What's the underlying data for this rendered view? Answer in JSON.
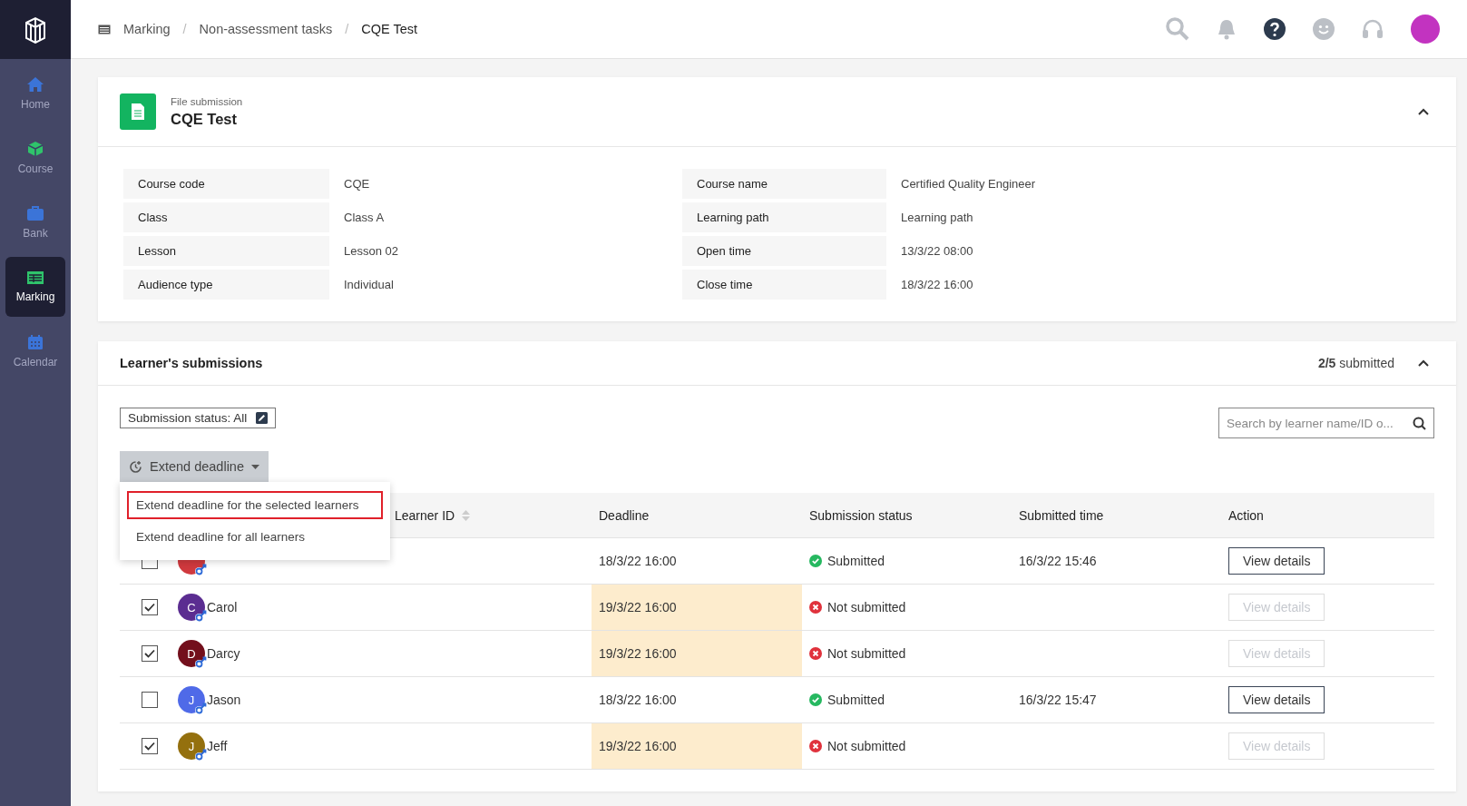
{
  "sidebar": {
    "items": [
      {
        "label": "Home",
        "kind": "home",
        "selected": false
      },
      {
        "label": "Course",
        "kind": "course",
        "selected": false
      },
      {
        "label": "Bank",
        "kind": "bank",
        "selected": false
      },
      {
        "label": "Marking",
        "kind": "marking",
        "selected": true
      },
      {
        "label": "Calendar",
        "kind": "calendar",
        "selected": false
      }
    ]
  },
  "breadcrumb": [
    {
      "kind": "link",
      "label": "Marking"
    },
    {
      "kind": "separator",
      "label": "/"
    },
    {
      "kind": "link",
      "label": "Non-assessment tasks"
    },
    {
      "kind": "separator",
      "label": "/"
    },
    {
      "kind": "current",
      "label": "CQE Test"
    }
  ],
  "task": {
    "type": "File submission",
    "title": "CQE Test",
    "expanded": true,
    "details": [
      {
        "label": "Course code",
        "value": "CQE"
      },
      {
        "label": "Course name",
        "value": "Certified Quality Engineer"
      },
      {
        "label": "Class",
        "value": "Class A"
      },
      {
        "label": "Learning path",
        "value": "Learning path"
      },
      {
        "label": "Lesson",
        "value": "Lesson 02"
      },
      {
        "label": "Open time",
        "value": "13/3/22 08:00"
      },
      {
        "label": "Audience type",
        "value": "Individual"
      },
      {
        "label": "Close time",
        "value": "18/3/22 16:00"
      }
    ]
  },
  "submissions": {
    "title": "Learner's submissions",
    "count": "2/5",
    "count_suffix": "submitted",
    "expanded": true,
    "filter": "Submission status: All",
    "search": {
      "placeholder": "Search by learner name/ID o..."
    },
    "extend_button": "Extend deadline",
    "menu": [
      {
        "label": "Extend deadline for the selected learners",
        "selected": true
      },
      {
        "label": "Extend deadline for all learners",
        "selected": false
      }
    ],
    "columns": [
      "Learner ID",
      "Deadline",
      "Submission status",
      "Submitted time",
      "Action"
    ],
    "rows": [
      {
        "checked": false,
        "color": "#d0393e",
        "deadline": "18/3/22 16:00",
        "extended": false,
        "status": "Submitted",
        "kind": "submitted",
        "time": "16/3/22 15:46",
        "action": "View details",
        "disabled": false
      },
      {
        "checked": true,
        "name": "Carol",
        "initial": "C",
        "color": "#5b2d91",
        "deadline": "19/3/22 16:00",
        "extended": true,
        "status": "Not submitted",
        "kind": "not_submitted",
        "action": "View details",
        "disabled": true
      },
      {
        "checked": true,
        "name": "Darcy",
        "initial": "D",
        "color": "#730f1c",
        "deadline": "19/3/22 16:00",
        "extended": true,
        "status": "Not submitted",
        "kind": "not_submitted",
        "action": "View details",
        "disabled": true
      },
      {
        "checked": false,
        "name": "Jason",
        "initial": "J",
        "color": "#4f6ae8",
        "deadline": "18/3/22 16:00",
        "extended": false,
        "status": "Submitted",
        "kind": "submitted",
        "time": "16/3/22 15:47",
        "action": "View details",
        "disabled": false
      },
      {
        "checked": true,
        "name": "Jeff",
        "initial": "J",
        "color": "#94700e",
        "deadline": "19/3/22 16:00",
        "extended": true,
        "status": "Not submitted",
        "kind": "not_submitted",
        "action": "View details",
        "disabled": true
      }
    ]
  }
}
